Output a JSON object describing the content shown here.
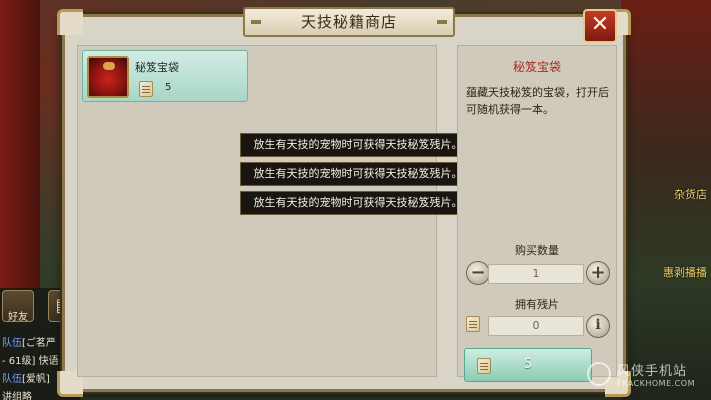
{
  "dialog": {
    "title": "天技秘籍商店",
    "close_glyph": "✕"
  },
  "item": {
    "name": "秘笈宝袋",
    "price": "5"
  },
  "tooltips": [
    "放生有天技的宠物时可获得天技秘笈残片。",
    "放生有天技的宠物时可获得天技秘笈残片。",
    "放生有天技的宠物时可获得天技秘笈残片。"
  ],
  "info": {
    "title": "秘笈宝袋",
    "description": "蕴藏天技秘笈的宝袋，打开后可随机获得一本。",
    "quantity_label": "购买数量",
    "quantity_value": "1",
    "owned_label": "拥有残片",
    "owned_value": "0",
    "buy_cost": "5"
  },
  "hud": {
    "friend_label": "好友",
    "chat": [
      {
        "tag": "队伍",
        "text": "[ご茗严"
      },
      {
        "tag": "",
        "text": "- 61级] 快语"
      },
      {
        "tag": "队伍",
        "text": "[爱帆]"
      },
      {
        "tag": "",
        "text": "讲组略"
      }
    ],
    "right_labels": [
      "杂货店",
      "惠剥播播"
    ]
  },
  "watermark": {
    "cn": "风侠手机站",
    "en": "FKACKHOME.COM"
  },
  "colors": {
    "dialog_bg": "#d8d4c8",
    "frame_gold": "#8c7748",
    "close_red": "#c43a28",
    "teal_button": "#a8d6c6",
    "info_title_red": "#b0281c"
  }
}
